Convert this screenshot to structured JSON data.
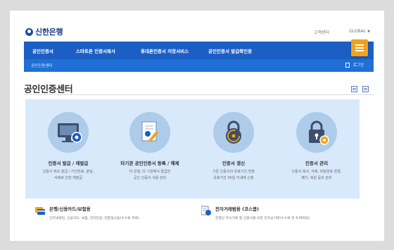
{
  "header": {
    "logo_text": "신한은행",
    "links": {
      "customer_center": "고객센터",
      "global": "GLOBAL"
    }
  },
  "nav": {
    "items": [
      {
        "label": "공인인증서"
      },
      {
        "label": "스마트폰 인증서복사"
      },
      {
        "label": "휴대폰인증서 저장서비스"
      },
      {
        "label": "공인인증서 발급확인증"
      }
    ]
  },
  "subnav": {
    "breadcrumb": "공인인증센터",
    "logout": "로그인"
  },
  "page": {
    "title": "공인인증센터"
  },
  "cards": [
    {
      "title": "인증서 발급 / 재발급",
      "desc": [
        "인증서 최초 발급 / 기간만료, 분실,",
        "삭제로 인한 재발급"
      ]
    },
    {
      "title": "타기관 공인인증서 등록 / 해제",
      "desc": [
        "타 은행, 타 기관에서 발급한",
        "공인 인증서 사용 관리"
      ]
    },
    {
      "title": "인증서 갱신",
      "desc": [
        "기존 인증서의 유효기간 연장",
        "유효기간 30일 이내에 신청"
      ]
    },
    {
      "title": "인증서 관리",
      "desc": [
        "인증서 복사, 삭제, 비밀번호 변경,",
        "폐기, 복원 등의 관리"
      ]
    }
  ],
  "bottom": [
    {
      "title": "은행/신용카드/보험용",
      "desc": "인터넷뱅킹, 신용카드, 보험, 전자민원, 연말정산용(수수료 무료)"
    },
    {
      "title": "전자거래범용 (코스콤)",
      "desc": "은행인 주식거래 등 인증서를 모든 전자상거래(수수료 연 4,400원)"
    }
  ],
  "colors": {
    "nav": "#1b5fc4",
    "subnav": "#1f6fd6",
    "accent": "#f0a31d",
    "panel": "#d8e9fb"
  },
  "icons": {
    "cards": [
      "monitor-certificate-icon",
      "document-pen-icon",
      "lock-refresh-icon",
      "lock-settings-icon"
    ],
    "bottom": [
      "card-stack-icon",
      "document-globe-icon"
    ]
  }
}
